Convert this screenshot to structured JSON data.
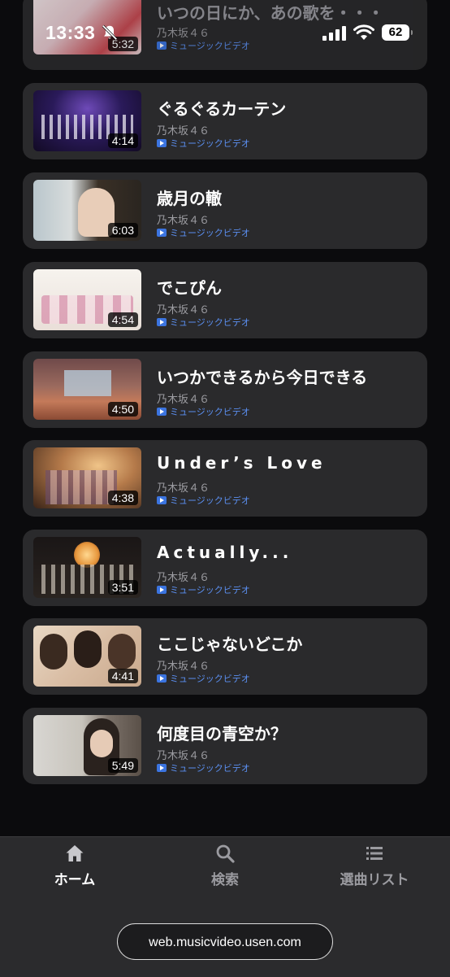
{
  "status_bar": {
    "time": "13:33",
    "battery": "62",
    "icons": [
      "bell-slash-icon",
      "cellular-signal-icon",
      "wifi-icon",
      "battery-icon"
    ]
  },
  "songs": [
    {
      "title": "いつの日にか、あの歌を・・・",
      "artist": "乃木坂４６",
      "type": "ミュージックビデオ",
      "duration": "5:32"
    },
    {
      "title": "ぐるぐるカーテン",
      "artist": "乃木坂４６",
      "type": "ミュージックビデオ",
      "duration": "4:14"
    },
    {
      "title": "歳月の轍",
      "artist": "乃木坂４６",
      "type": "ミュージックビデオ",
      "duration": "6:03"
    },
    {
      "title": "でこぴん",
      "artist": "乃木坂４６",
      "type": "ミュージックビデオ",
      "duration": "4:54"
    },
    {
      "title": "いつかできるから今日できる",
      "artist": "乃木坂４６",
      "type": "ミュージックビデオ",
      "duration": "4:50"
    },
    {
      "title": "Under’s Love",
      "artist": "乃木坂４６",
      "type": "ミュージックビデオ",
      "duration": "4:38"
    },
    {
      "title": "Actually...",
      "artist": "乃木坂４６",
      "type": "ミュージックビデオ",
      "duration": "3:51"
    },
    {
      "title": "ここじゃないどこか",
      "artist": "乃木坂４６",
      "type": "ミュージックビデオ",
      "duration": "4:41"
    },
    {
      "title": "何度目の青空か？",
      "artist": "乃木坂４６",
      "type": "ミュージックビデオ",
      "duration": "5:49"
    }
  ],
  "nav": {
    "home": "ホーム",
    "search": "検索",
    "playlist": "選曲リスト"
  },
  "browser": {
    "url": "web.musicvideo.usen.com"
  },
  "colors": {
    "background": "#0b0b0d",
    "card": "#2a2a2c",
    "accent": "#5b8ff0",
    "nav_bar": "#2b2b2d"
  }
}
